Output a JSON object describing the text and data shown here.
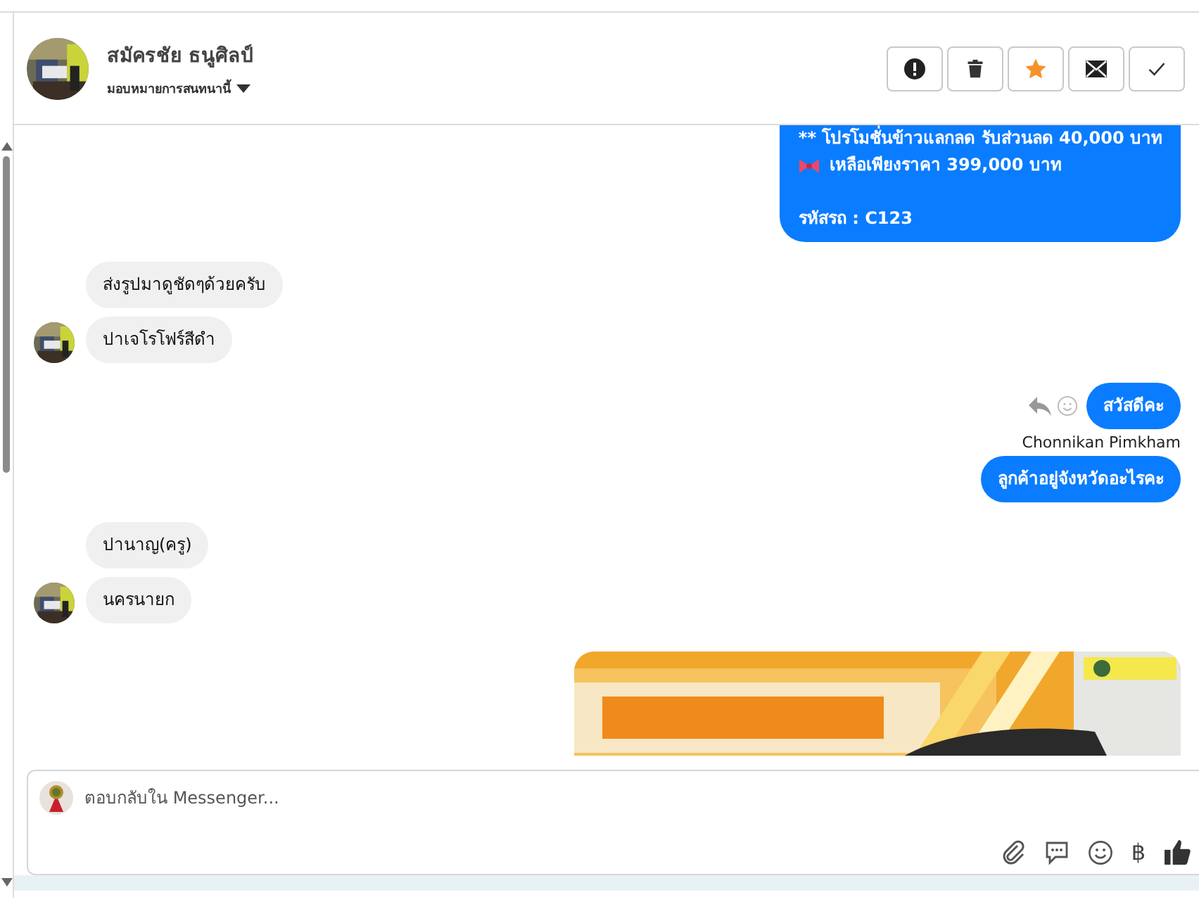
{
  "header": {
    "name": "สมัครชัย ธนูศิลป์",
    "subtitle": "มอบหมายการสนทนานี้",
    "actions": [
      {
        "kind": "alert"
      },
      {
        "kind": "trash"
      },
      {
        "kind": "star"
      },
      {
        "kind": "mail"
      },
      {
        "kind": "check"
      }
    ]
  },
  "messages": [
    {
      "kind": "outgoing",
      "lines": [
        {
          "text": "** โปรโมชั่นข้าวแลกลด รับส่วนลด 40,000 บาท"
        },
        {
          "text": "เหลือเพียงราคา 399,000 บาท",
          "kind": "decorated"
        },
        {
          "text": "รหัสรถ : C123",
          "spaced": true
        }
      ],
      "continued": true
    },
    {
      "kind": "incoming",
      "lines": [
        {
          "text": "ส่งรูปมาดูชัดๆด้วยครับ"
        }
      ],
      "avatar": false
    },
    {
      "kind": "incoming",
      "lines": [
        {
          "text": "ปาเจโรโฟร์สีดำ"
        }
      ],
      "avatar": true
    },
    {
      "kind": "outgoing",
      "lines": [
        {
          "text": "สวัสดีคะ"
        }
      ],
      "actions": true,
      "sender": "Chonnikan Pimkham"
    },
    {
      "kind": "outgoing",
      "lines": [
        {
          "text": "ลูกค้าอยู่จังหวัดอะไรคะ"
        }
      ]
    },
    {
      "kind": "incoming",
      "lines": [
        {
          "text": "ปานาญ(ครู)"
        }
      ],
      "avatar": false
    },
    {
      "kind": "incoming",
      "lines": [
        {
          "text": "นครนายก"
        }
      ],
      "avatar": true
    },
    {
      "kind": "picture"
    }
  ],
  "composer": {
    "placeholder": "ตอบกลับใน Messenger...",
    "tools": [
      {
        "kind": "attach"
      },
      {
        "kind": "comment"
      },
      {
        "kind": "emoji"
      },
      {
        "kind": "currency",
        "symbol": "฿"
      },
      {
        "kind": "like"
      }
    ]
  }
}
